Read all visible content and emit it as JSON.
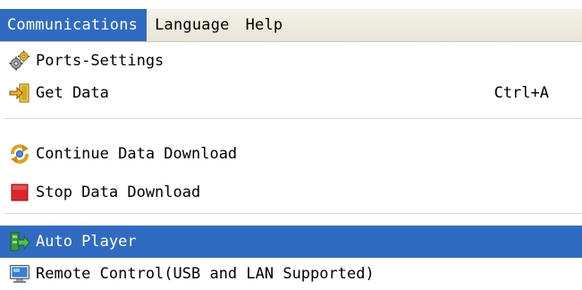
{
  "menubar": {
    "items": [
      {
        "label": "Communications",
        "active": true
      },
      {
        "label": "Language",
        "active": false
      },
      {
        "label": "Help",
        "active": false
      }
    ]
  },
  "dropdown": {
    "items": [
      {
        "label": "Ports-Settings",
        "shortcut": "",
        "icon": "gears-icon"
      },
      {
        "label": "Get Data",
        "shortcut": "Ctrl+A",
        "icon": "import-icon"
      },
      {
        "label": "Continue Data Download",
        "shortcut": "",
        "icon": "refresh-icon"
      },
      {
        "label": "Stop Data Download",
        "shortcut": "",
        "icon": "stop-icon"
      },
      {
        "label": "Auto Player",
        "shortcut": "",
        "icon": "auto-player-icon",
        "highlighted": true
      },
      {
        "label": "Remote Control(USB and LAN Supported)",
        "shortcut": "",
        "icon": "monitor-icon"
      }
    ]
  },
  "colors": {
    "highlight": "#2f6bc2",
    "menubar_bg": "#ece9d8",
    "stop_red": "#d9262b"
  }
}
